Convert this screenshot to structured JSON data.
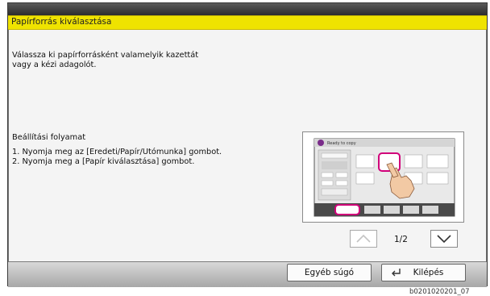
{
  "window": {
    "title": "Papírforrás kiválasztása"
  },
  "intro_text": "Válassza ki papírforrásként valamelyik kazettát\nvagy a kézi adagolót.",
  "settings": {
    "heading": "Beállítási folyamat",
    "steps": [
      "1. Nyomja meg az [Eredeti/Papír/Utómunka] gombot.",
      "2. Nyomja meg a [Papír kiválasztása] gombot."
    ]
  },
  "illustration": {
    "screen_heading": "Ready to copy",
    "icons": [
      "touch-hand-icon"
    ]
  },
  "pager": {
    "current": "1/2"
  },
  "footer": {
    "help_label": "Egyéb súgó",
    "exit_label": "Kilépés"
  },
  "caption": "b0201020201_07",
  "colors": {
    "title_bar": "#efe300",
    "highlight": "#d1007a"
  }
}
